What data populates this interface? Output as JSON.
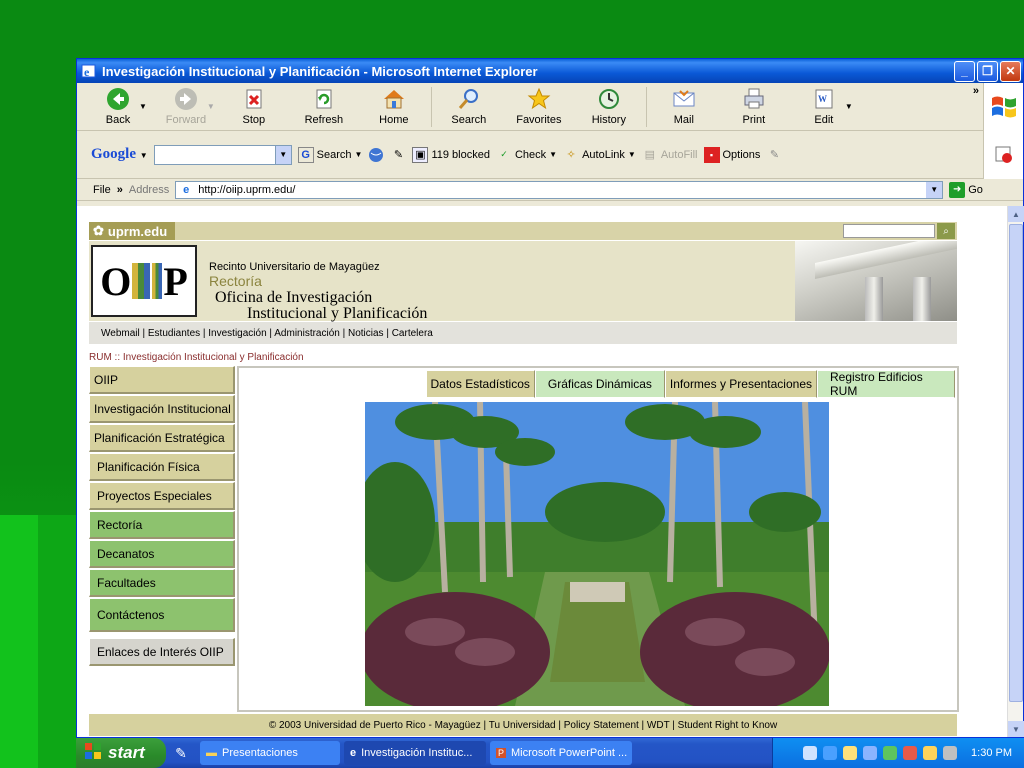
{
  "window": {
    "title": "Investigación Institucional y Planificación - Microsoft Internet Explorer",
    "controls": [
      "minimize",
      "restore",
      "close"
    ]
  },
  "toolbar": {
    "back": "Back",
    "forward": "Forward",
    "stop": "Stop",
    "refresh": "Refresh",
    "home": "Home",
    "search": "Search",
    "favorites": "Favorites",
    "history": "History",
    "mail": "Mail",
    "print": "Print",
    "edit": "Edit"
  },
  "google_toolbar": {
    "logo": "Google",
    "search_value": "",
    "search_btn": "Search",
    "blocked": "119 blocked",
    "check": "Check",
    "autolink": "AutoLink",
    "autofill": "AutoFill",
    "options": "Options"
  },
  "address_bar": {
    "menu": "File",
    "label": "Address",
    "url": "http://oiip.uprm.edu/",
    "go": "Go"
  },
  "site": {
    "tag": "uprm.edu",
    "search_value": "",
    "logo_text": "OIIP",
    "banner": {
      "line1": "Recinto Universitario de Mayagüez",
      "line2": "Rectoría",
      "line3": "Oficina de Investigación",
      "line4": "Institucional y Planificación"
    },
    "top_links": "Webmail | Estudiantes | Investigación | Administración | Noticias | Cartelera",
    "breadcrumb": "RUM :: Investigación Institucional y Planificación",
    "nav": [
      "OIIP",
      "Investigación Institucional",
      "Planificación Estratégica",
      "Planificación Física",
      "Proyectos Especiales",
      "Rectoría",
      "Decanatos",
      "Facultades",
      "Contáctenos",
      "Enlaces de Interés OIIP"
    ],
    "tabs": [
      "Datos Estadísticos",
      "Gráficas Dinámicas",
      "Informes y Presentaciones",
      "Registro Edificios RUM"
    ],
    "footer": "© 2003 Universidad de Puerto Rico - Mayagüez | Tu Universidad | Policy Statement | WDT | Student Right to Know"
  },
  "taskbar": {
    "start": "start",
    "tasks": [
      "Presentaciones",
      "Investigación Instituc...",
      "Microsoft PowerPoint ..."
    ],
    "clock": "1:30 PM"
  }
}
